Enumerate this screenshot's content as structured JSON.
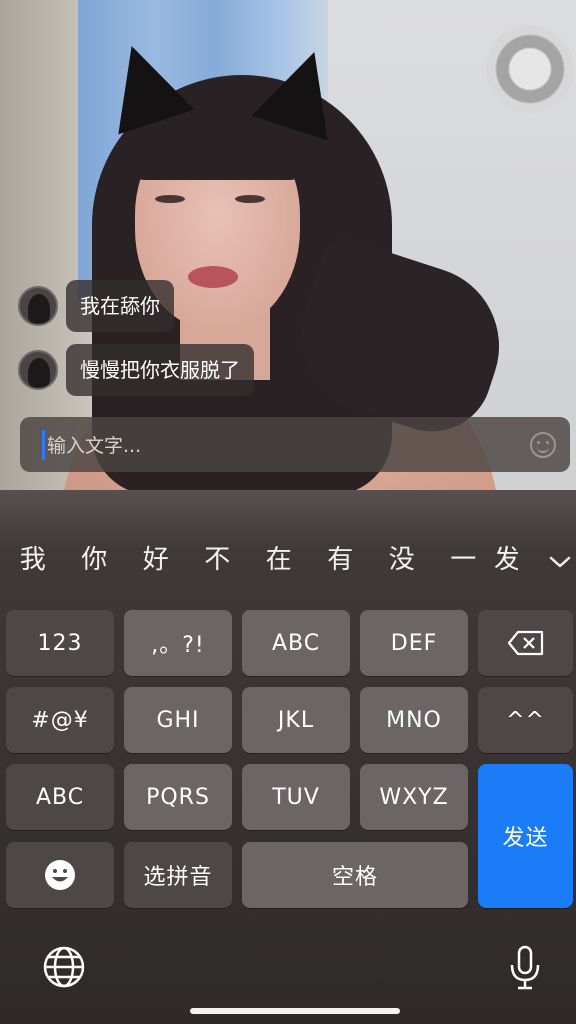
{
  "chat": {
    "messages": [
      {
        "text": "我在舔你"
      },
      {
        "text": "慢慢把你衣服脱了"
      }
    ],
    "input_placeholder": "输入文字..."
  },
  "keyboard": {
    "candidates": [
      "我",
      "你",
      "好",
      "不",
      "在",
      "有",
      "没",
      "一",
      "发"
    ],
    "rows": {
      "r1": [
        "123",
        ",。?!",
        "ABC",
        "DEF"
      ],
      "r2": [
        "#@¥",
        "GHI",
        "JKL",
        "MNO",
        "^^"
      ],
      "r3": [
        "ABC",
        "PQRS",
        "TUV",
        "WXYZ"
      ],
      "r4": [
        "选拼音",
        "空格"
      ]
    },
    "send_label": "发送"
  },
  "icons": {
    "record": "record-icon",
    "emoji_input": "emoji-icon",
    "backspace": "backspace-icon",
    "chevron": "chevron-down-icon",
    "emoji_key": "emoji-icon",
    "globe": "globe-icon",
    "mic": "microphone-icon"
  },
  "colors": {
    "send_button": "#1a7cf7",
    "caret": "#3478f6",
    "key": "#6b6665",
    "key_dark": "#4d4847"
  }
}
